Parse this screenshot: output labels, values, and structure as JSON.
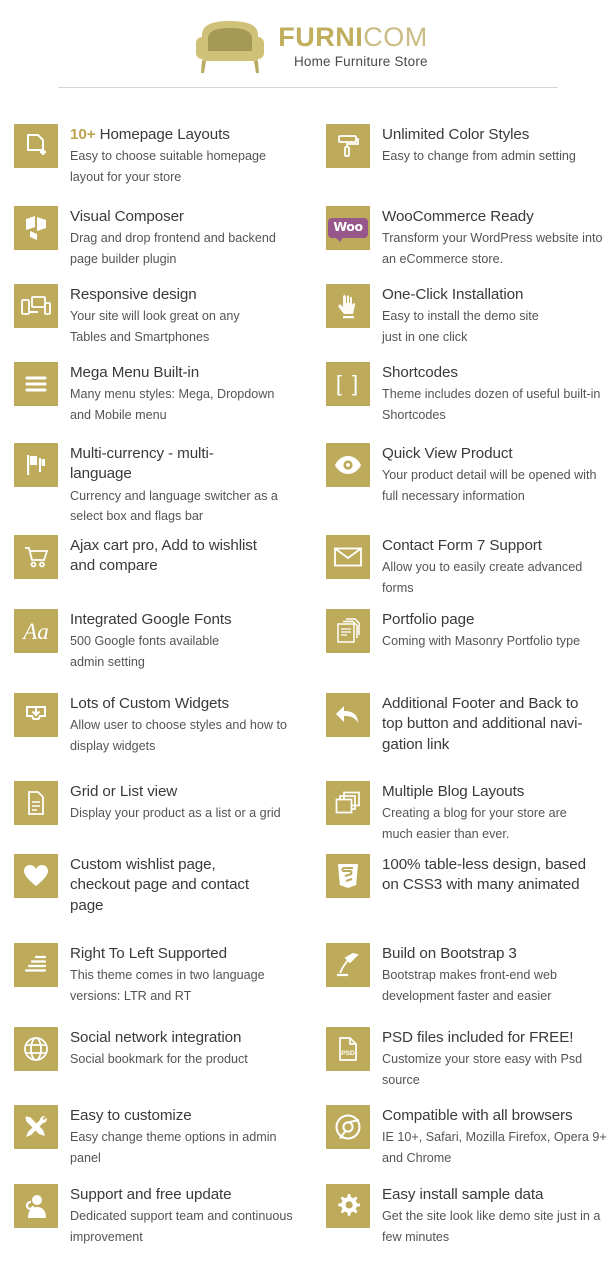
{
  "brand": {
    "name_strong": "FURNI",
    "name_light": "COM",
    "tagline": "Home Furniture Store",
    "logo_icon": "armchair-icon",
    "gold": "#bdab5b",
    "gold_text": "#c0ae5d"
  },
  "features_left": [
    {
      "icon": "document-plus-icon",
      "title_highlight": "10+",
      "title": " Homepage Layouts",
      "desc": "Easy to choose suitable homepage\nlayout for your store"
    },
    {
      "icon": "visual-composer-icon",
      "title": "Visual Composer",
      "desc": "Drag and drop frontend and backend\npage builder plugin"
    },
    {
      "icon": "responsive-devices-icon",
      "title": "Responsive design",
      "desc": "Your site will look great on any\nTables and Smartphones"
    },
    {
      "icon": "hamburger-menu-icon",
      "title": "Mega Menu Built-in",
      "desc": "Many menu styles: Mega, Dropdown\nand Mobile menu"
    },
    {
      "icon": "flags-icon",
      "title": "Multi-currency - multi-\nlanguage",
      "desc": "Currency and language switcher as a\nselect box and flags bar"
    },
    {
      "icon": "shopping-cart-icon",
      "title": "Ajax cart pro, Add to wishlist\nand compare",
      "desc": ""
    },
    {
      "icon": "font-aa-icon",
      "title": "Integrated Google Fonts",
      "desc": "500 Google fonts available\nadmin setting"
    },
    {
      "icon": "widget-download-icon",
      "title": "Lots of Custom Widgets",
      "desc": "Allow user to choose styles and how to\ndisplay widgets"
    },
    {
      "icon": "list-document-icon",
      "title": "Grid or List view",
      "desc": "Display your product as a list or a grid"
    },
    {
      "icon": "heart-icon",
      "title": "Custom wishlist page,\ncheckout page and contact\npage",
      "desc": ""
    },
    {
      "icon": "rtl-align-icon",
      "title": "Right To Left Supported",
      "desc": "This theme comes in two language\nversions: LTR and RT"
    },
    {
      "icon": "globe-icon",
      "title": "Social network integration",
      "desc": "Social bookmark for the product"
    },
    {
      "icon": "tools-wrench-icon",
      "title": "Easy to customize",
      "desc": "Easy change theme options in admin\npanel"
    },
    {
      "icon": "support-agent-icon",
      "title": "Support and  free update",
      "desc": "Dedicated support team and continuous\nimprovement"
    }
  ],
  "features_right": [
    {
      "icon": "paint-roller-icon",
      "title": "Unlimited Color Styles",
      "desc": "Easy to change from admin setting"
    },
    {
      "icon": "woocommerce-icon",
      "icon_text": "Woo",
      "title": "WooCommerce Ready",
      "desc": "Transform your WordPress website into\nan eCommerce store."
    },
    {
      "icon": "click-hand-icon",
      "title": "One-Click Installation",
      "desc": "Easy to install the demo site\njust in one click"
    },
    {
      "icon": "brackets-icon",
      "icon_text": "[ ]",
      "title": "Shortcodes",
      "desc": "Theme includes dozen of useful built-in\nShortcodes"
    },
    {
      "icon": "eye-icon",
      "title": "Quick View Product",
      "desc": "Your product detail will be opened with\nfull necessary information"
    },
    {
      "icon": "envelope-icon",
      "title": "Contact Form 7 Support",
      "desc": "Allow you to easily create advanced\nforms"
    },
    {
      "icon": "portfolio-pages-icon",
      "title": "Portfolio page",
      "desc": "Coming with Masonry Portfolio type"
    },
    {
      "icon": "back-arrow-icon",
      "title": "Additional Footer and Back to\ntop button and additional navi-\ngation link",
      "desc": ""
    },
    {
      "icon": "layers-icon",
      "title": "Multiple Blog Layouts",
      "desc": "Creating a blog for your store are\nmuch easier than ever."
    },
    {
      "icon": "css3-icon",
      "title": "100% table-less design, based\non CSS3 with many animated",
      "desc": ""
    },
    {
      "icon": "desk-lamp-icon",
      "title": "Build on Bootstrap 3",
      "desc": "Bootstrap makes front-end web\ndevelopment faster and easier"
    },
    {
      "icon": "psd-file-icon",
      "icon_text": "PSD",
      "title": "PSD files included for FREE!",
      "desc": "Customize your store easy with Psd\nsource"
    },
    {
      "icon": "chrome-browser-icon",
      "title": "Compatible with all browsers",
      "desc": "IE 10+, Safari, Mozilla Firefox, Opera 9+\nand Chrome"
    },
    {
      "icon": "gear-icon",
      "title": "Easy install sample data",
      "desc": "Get the site look like demo site just in a\nfew minutes"
    }
  ]
}
